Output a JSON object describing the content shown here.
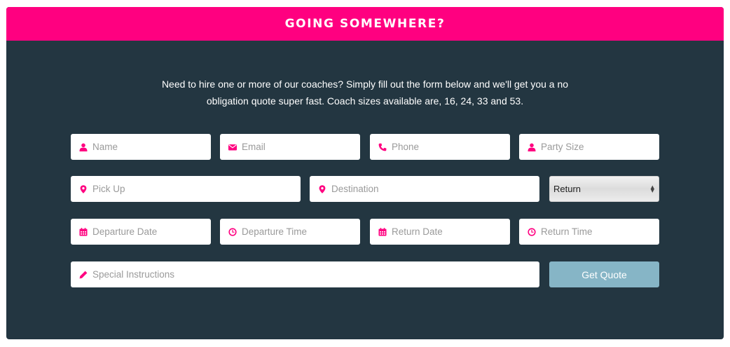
{
  "header": {
    "title": "GOING SOMEWHERE?"
  },
  "intro": {
    "line1": "Need to hire one or more of our coaches? Simply fill out the form below and we'll get you a no",
    "line2": "obligation quote super fast. Coach sizes available are, 16, 24, 33 and 53."
  },
  "form": {
    "name": {
      "placeholder": "Name",
      "icon": "user-icon"
    },
    "email": {
      "placeholder": "Email",
      "icon": "envelope-icon"
    },
    "phone": {
      "placeholder": "Phone",
      "icon": "phone-icon"
    },
    "party_size": {
      "placeholder": "Party Size",
      "icon": "user-icon"
    },
    "pick_up": {
      "placeholder": "Pick Up",
      "icon": "map-marker-icon"
    },
    "destination": {
      "placeholder": "Destination",
      "icon": "map-marker-icon"
    },
    "trip_type": {
      "selected": "Return"
    },
    "departure_date": {
      "placeholder": "Departure Date",
      "icon": "calendar-icon"
    },
    "departure_time": {
      "placeholder": "Departure Time",
      "icon": "clock-icon"
    },
    "return_date": {
      "placeholder": "Return Date",
      "icon": "calendar-icon"
    },
    "return_time": {
      "placeholder": "Return Time",
      "icon": "clock-icon"
    },
    "special_instructions": {
      "placeholder": "Special Instructions",
      "icon": "pencil-icon"
    },
    "submit_label": "Get Quote"
  },
  "colors": {
    "accent": "#ff0080",
    "panel": "#233641",
    "button": "#86b5c6"
  }
}
